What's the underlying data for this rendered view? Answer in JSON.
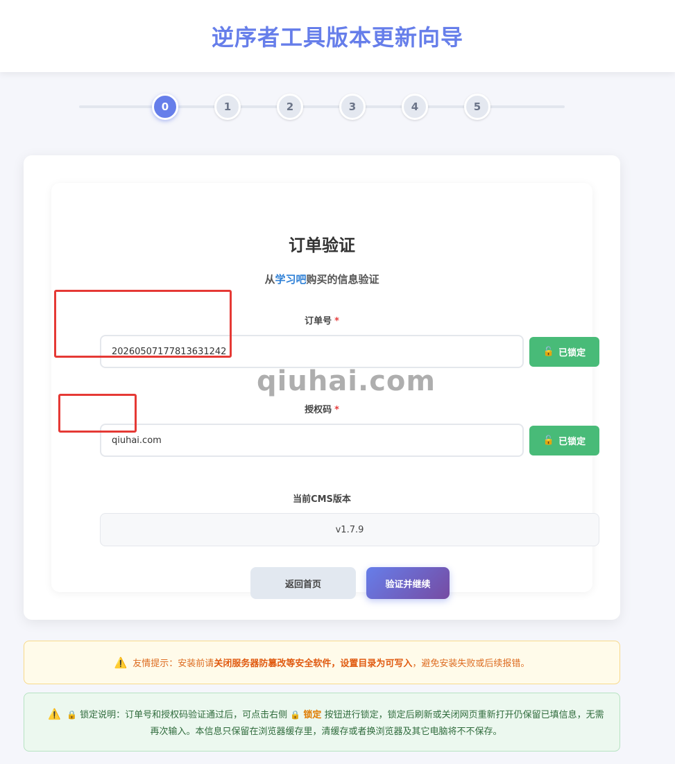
{
  "header": {
    "title": "逆序者工具版本更新向导"
  },
  "steps": [
    "0",
    "1",
    "2",
    "3",
    "4",
    "5"
  ],
  "card": {
    "title": "订单验证",
    "subtitle_prefix": "从",
    "subtitle_highlight": "学习吧",
    "subtitle_suffix": "购买的信息验证",
    "order": {
      "label": "订单号",
      "required": "*",
      "value": "20260507177813631242"
    },
    "auth": {
      "label": "授权码",
      "required": "*",
      "value": "qiuhai.com"
    },
    "lock_button": {
      "label": "已锁定",
      "icon": "🔓"
    },
    "version": {
      "label": "当前CMS版本",
      "value": "v1.7.9"
    },
    "buttons": {
      "back": "返回首页",
      "verify": "验证并继续"
    }
  },
  "watermark": "qiuhai.com",
  "notices": {
    "warn": {
      "icon": "⚠️",
      "prefix": "友情提示：安装前请",
      "bold1": "关闭服务器防篡改等安全软件",
      "sep": "，",
      "bold2": "设置目录为可写入",
      "suffix": "，避免安装失败或后续报错。"
    },
    "lock": {
      "icon": "⚠️",
      "lock_icon": "🔒",
      "part1": "锁定说明：订单号和授权码验证通过后，可点击右侧",
      "highlight": "锁定",
      "part2": "按钮进行锁定，锁定后刷新或关闭网页重新打开仍保留已填信息，无需再次输入。本信息只保留在浏览器缓存里，清缓存或者换浏览器及其它电脑将不不保存。"
    }
  },
  "colors": {
    "accent": "#667eea",
    "success": "#48bb78",
    "annotation": "#e53935"
  }
}
